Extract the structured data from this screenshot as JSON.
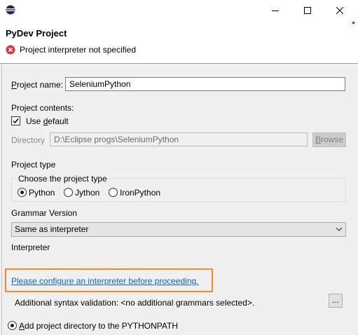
{
  "colors": {
    "error": "#d9363e",
    "link": "#0a64c8",
    "highlight": "#f08a2c",
    "window_close_marker": "#e81123"
  },
  "icons": {
    "app": "eclipse-icon",
    "error": "error-icon",
    "minimize": "minimize-icon",
    "maximize": "maximize-icon",
    "close": "close-icon",
    "dropdown": "chevron-down-icon"
  },
  "header": {
    "title": "PyDev Project",
    "error_message": "Project interpreter not specified"
  },
  "form": {
    "project_name": {
      "label_mnemonic": "P",
      "label_rest": "roject name:",
      "value": "SeleniumPython"
    },
    "project_contents": {
      "label": "Project contents:",
      "use_default_prefix": "Use ",
      "use_default_mnemonic": "d",
      "use_default_suffix": "efault",
      "directory_label": "Directory",
      "directory_value": "D:\\Eclipse progs\\SeleniumPython",
      "browse_mnemonic": "B",
      "browse_rest": "rowse"
    },
    "project_type": {
      "label": "Project type",
      "group_label": "Choose the project type",
      "options": [
        "Python",
        "Jython",
        "IronPython"
      ],
      "selected": "Python"
    },
    "grammar": {
      "label": "Grammar Version",
      "value": "Same as interpreter"
    },
    "interpreter": {
      "label": "Interpreter",
      "configure_link": "Please configure an interpreter before proceeding."
    },
    "syntax": {
      "label": "Additional syntax validation: <no additional grammars selected>.",
      "button_label": "..."
    },
    "pythonpath": {
      "label_mnemonic": "A",
      "label_rest": "dd project directory to the PYTHONPATH"
    }
  }
}
